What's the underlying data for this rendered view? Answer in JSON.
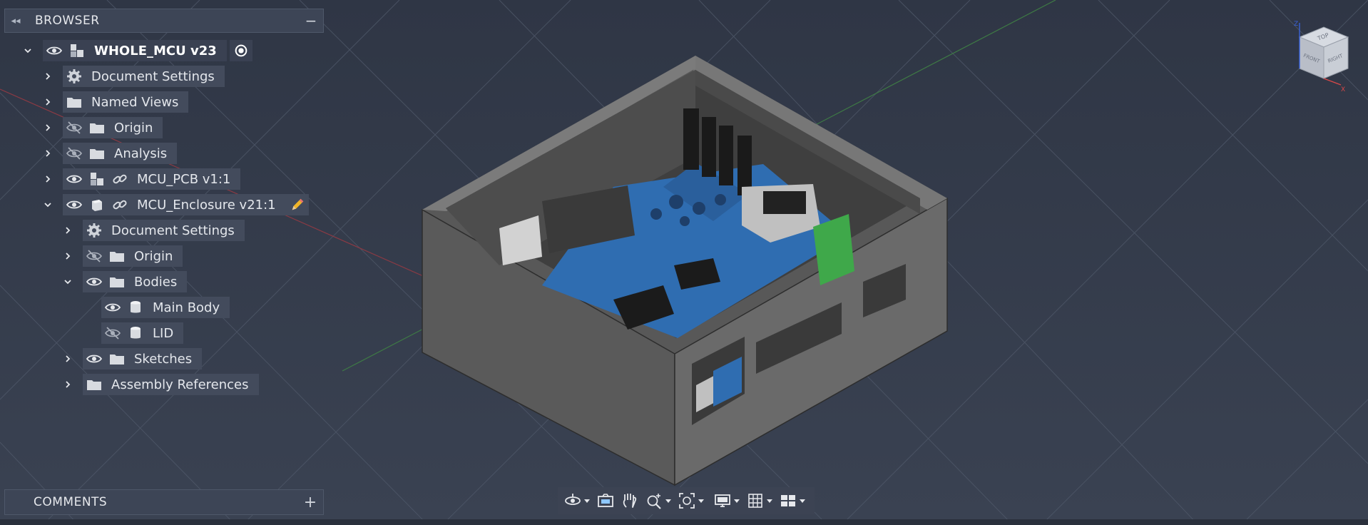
{
  "browser": {
    "title": "BROWSER",
    "collapse_icon": "double-chevron-left-icon",
    "minimize_icon": "minus-icon"
  },
  "tree": [
    {
      "label": "WHOLE_MCU v23",
      "visible": true,
      "type": "assembly",
      "expanded": true,
      "active": true
    },
    {
      "label": "Document Settings",
      "type": "settings",
      "expanded": false
    },
    {
      "label": "Named Views",
      "type": "folder",
      "expanded": false
    },
    {
      "label": "Origin",
      "visible": false,
      "type": "folder",
      "expanded": false
    },
    {
      "label": "Analysis",
      "visible": false,
      "type": "folder",
      "expanded": false
    },
    {
      "label": "MCU_PCB v1:1",
      "visible": true,
      "type": "linked-assembly",
      "expanded": false
    },
    {
      "label": "MCU_Enclosure v21:1",
      "visible": true,
      "type": "linked-component",
      "expanded": true,
      "editing": true
    },
    {
      "label": "Document Settings",
      "type": "settings",
      "expanded": false
    },
    {
      "label": "Origin",
      "visible": false,
      "type": "folder",
      "expanded": false
    },
    {
      "label": "Bodies",
      "visible": true,
      "type": "folder",
      "expanded": true
    },
    {
      "label": "Main Body",
      "visible": true,
      "type": "body"
    },
    {
      "label": "LID",
      "visible": false,
      "type": "body"
    },
    {
      "label": "Sketches",
      "visible": true,
      "type": "folder",
      "expanded": false
    },
    {
      "label": "Assembly References",
      "type": "folder",
      "expanded": false
    }
  ],
  "comments": {
    "title": "COMMENTS",
    "add_icon": "plus-icon"
  },
  "toolbar": [
    "orbit-icon",
    "look-at-icon",
    "pan-icon",
    "zoom-icon",
    "fit-icon",
    "display-settings-icon",
    "grid-icon",
    "viewports-icon"
  ],
  "viewcube": {
    "top": "TOP",
    "front": "FRONT",
    "right": "RIGHT",
    "axis_z": "Z",
    "axis_x": "X"
  },
  "colors": {
    "background": "#333a49",
    "panel": "#3d4556",
    "accent_pencil": "#f0b428",
    "pcb": "#2f6db1",
    "enclosure": "#6b6b6b"
  }
}
